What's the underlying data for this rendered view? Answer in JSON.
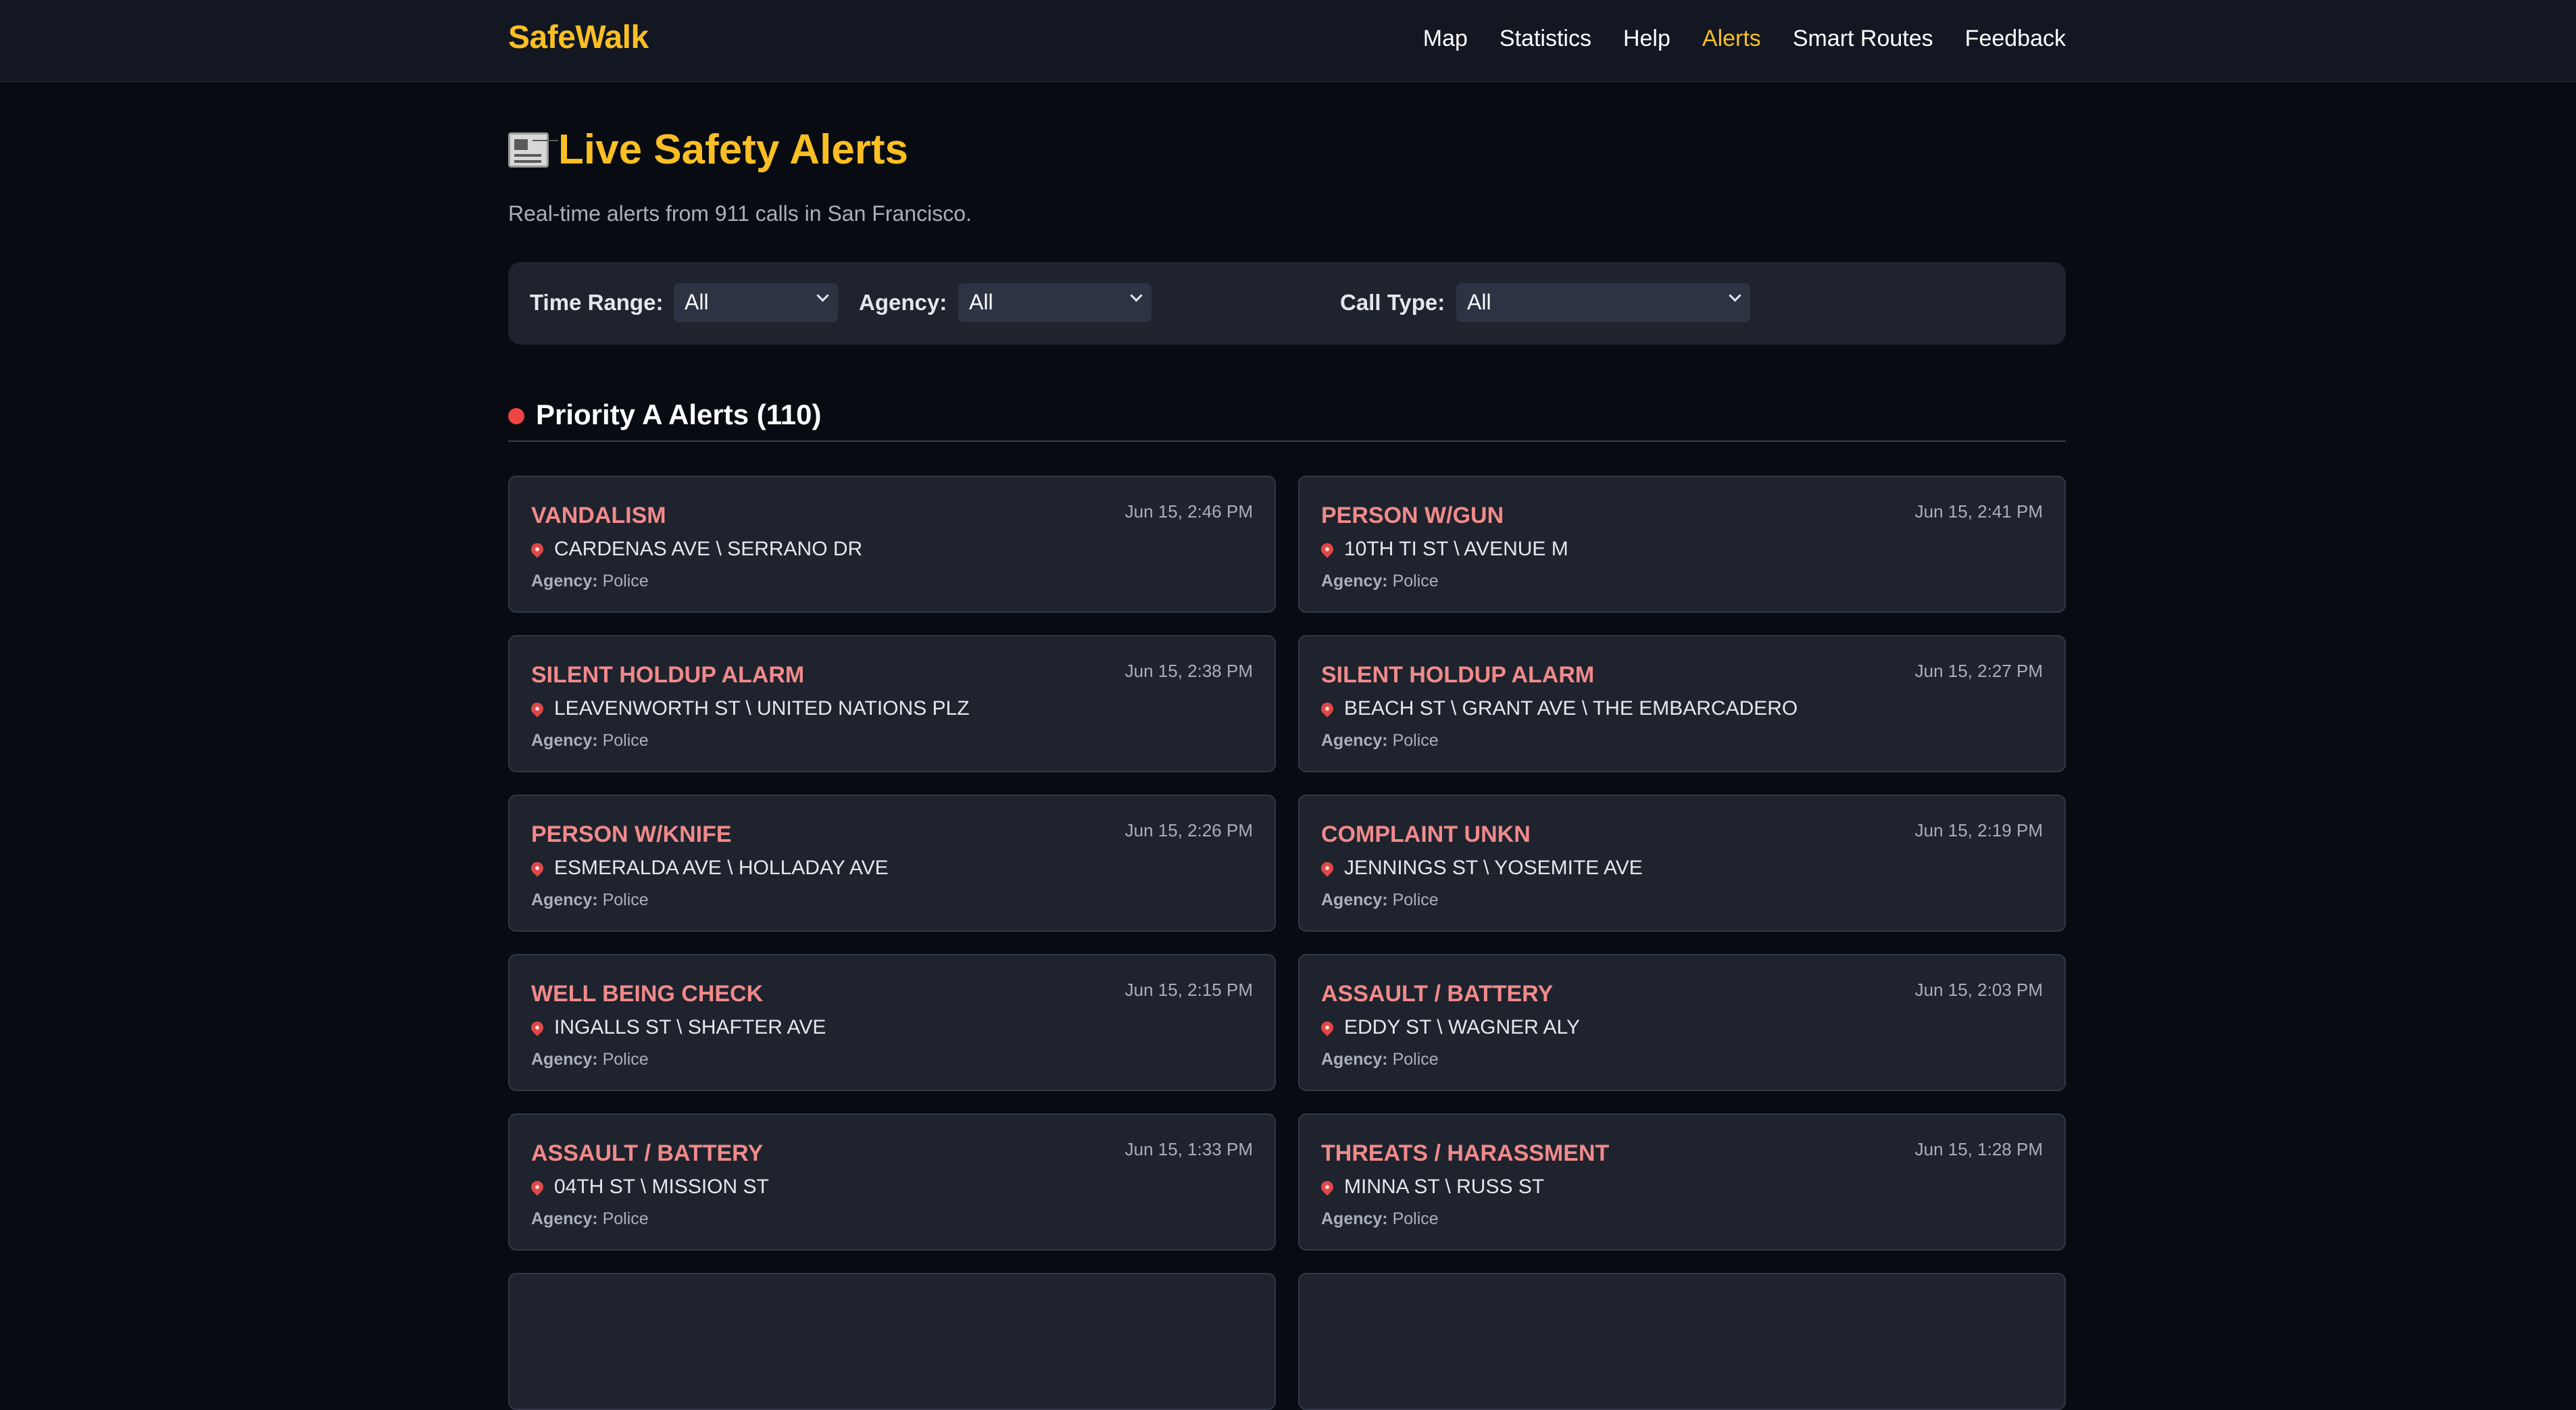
{
  "nav": {
    "brand": "SafeWalk",
    "links": [
      {
        "label": "Map",
        "active": false
      },
      {
        "label": "Statistics",
        "active": false
      },
      {
        "label": "Help",
        "active": false
      },
      {
        "label": "Alerts",
        "active": true
      },
      {
        "label": "Smart Routes",
        "active": false
      },
      {
        "label": "Feedback",
        "active": false
      }
    ]
  },
  "header": {
    "icon": "newspaper-icon",
    "title": "Live Safety Alerts",
    "subtitle": "Real-time alerts from 911 calls in San Francisco."
  },
  "filters": {
    "time_range": {
      "label": "Time Range:",
      "value": "All"
    },
    "agency": {
      "label": "Agency:",
      "value": "All"
    },
    "call_type": {
      "label": "Call Type:",
      "value": "All"
    }
  },
  "section": {
    "title": "Priority A Alerts (110)"
  },
  "agency_label": "Agency:",
  "colors": {
    "accent": "#fbbf24",
    "alert_type": "#f08a8a",
    "priority_dot": "#ef4444"
  },
  "alerts": [
    {
      "type": "VANDALISM",
      "time": "Jun 15, 2:46 PM",
      "location": "CARDENAS AVE \\ SERRANO DR",
      "agency": "Police"
    },
    {
      "type": "PERSON W/GUN",
      "time": "Jun 15, 2:41 PM",
      "location": "10TH TI ST \\ AVENUE M",
      "agency": "Police"
    },
    {
      "type": "SILENT HOLDUP ALARM",
      "time": "Jun 15, 2:38 PM",
      "location": "LEAVENWORTH ST \\ UNITED NATIONS PLZ",
      "agency": "Police"
    },
    {
      "type": "SILENT HOLDUP ALARM",
      "time": "Jun 15, 2:27 PM",
      "location": "BEACH ST \\ GRANT AVE \\ THE EMBARCADERO",
      "agency": "Police"
    },
    {
      "type": "PERSON W/KNIFE",
      "time": "Jun 15, 2:26 PM",
      "location": "ESMERALDA AVE \\ HOLLADAY AVE",
      "agency": "Police"
    },
    {
      "type": "COMPLAINT UNKN",
      "time": "Jun 15, 2:19 PM",
      "location": "JENNINGS ST \\ YOSEMITE AVE",
      "agency": "Police"
    },
    {
      "type": "WELL BEING CHECK",
      "time": "Jun 15, 2:15 PM",
      "location": "INGALLS ST \\ SHAFTER AVE",
      "agency": "Police"
    },
    {
      "type": "ASSAULT / BATTERY",
      "time": "Jun 15, 2:03 PM",
      "location": "EDDY ST \\ WAGNER ALY",
      "agency": "Police"
    },
    {
      "type": "ASSAULT / BATTERY",
      "time": "Jun 15, 1:33 PM",
      "location": "04TH ST \\ MISSION ST",
      "agency": "Police"
    },
    {
      "type": "THREATS / HARASSMENT",
      "time": "Jun 15, 1:28 PM",
      "location": "MINNA ST \\ RUSS ST",
      "agency": "Police"
    }
  ]
}
